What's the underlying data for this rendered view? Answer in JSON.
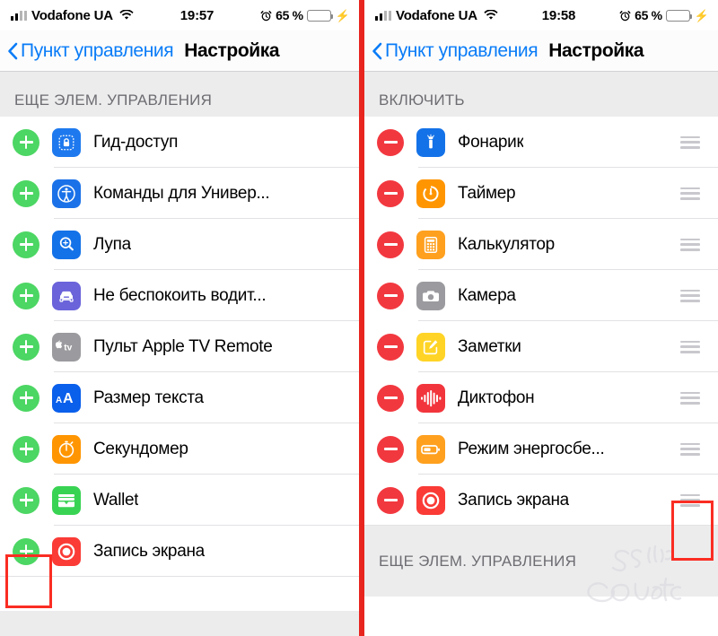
{
  "status_bar": {
    "carrier": "Vodafone UA",
    "signal_icon": "cellular-signal-icon",
    "wifi_icon": "wifi-icon",
    "alarm_icon": "alarm-clock-icon",
    "battery_icon": "battery-icon",
    "charging_icon": "lightning-bolt-icon",
    "battery_percent": "65 %",
    "battery_level": 65,
    "battery_color": "#ffcc00",
    "time_left": "19:57",
    "time_right": "19:58"
  },
  "nav": {
    "back_icon": "chevron-left-icon",
    "back_label": "Пункт управления",
    "title": "Настройка",
    "tint_color": "#0a7cf7"
  },
  "left_panel": {
    "section_header": "ЕЩЕ ЭЛЕМ. УПРАВЛЕНИЯ",
    "items": [
      {
        "label": "Гид-доступ",
        "icon": "guided-access-icon",
        "icon_color": "#1e79ee",
        "toggle": "add-icon"
      },
      {
        "label": "Команды для Универ...",
        "icon": "accessibility-icon",
        "icon_color": "#1b72e8",
        "toggle": "add-icon"
      },
      {
        "label": "Лупа",
        "icon": "magnifier-icon",
        "icon_color": "#1472e8",
        "toggle": "add-icon"
      },
      {
        "label": "Не беспокоить водит...",
        "icon": "car-icon",
        "icon_color": "#6a63da",
        "toggle": "add-icon"
      },
      {
        "label": "Пульт Apple TV Remote",
        "icon": "apple-tv-remote-icon",
        "icon_color": "#9b9b9f",
        "toggle": "add-icon"
      },
      {
        "label": "Размер текста",
        "icon": "text-size-icon",
        "icon_color": "#0a5feb",
        "toggle": "add-icon"
      },
      {
        "label": "Секундомер",
        "icon": "stopwatch-icon",
        "icon_color": "#ff9500",
        "toggle": "add-icon"
      },
      {
        "label": "Wallet",
        "icon": "wallet-icon",
        "icon_color": "#39d353",
        "toggle": "add-icon"
      },
      {
        "label": "Запись экрана",
        "icon": "screen-record-icon",
        "icon_color": "#fa3b36",
        "toggle": "add-icon"
      }
    ],
    "highlight": {
      "target": "add-toggle-screen-recording",
      "color": "#fa2d23"
    }
  },
  "right_panel": {
    "section_header_top": "ВКЛЮЧИТЬ",
    "section_header_bottom": "ЕЩЕ ЭЛЕМ. УПРАВЛЕНИЯ",
    "items": [
      {
        "label": "Фонарик",
        "icon": "flashlight-icon",
        "icon_color": "#1472e8",
        "toggle": "remove-icon",
        "handle": "drag-handle-icon"
      },
      {
        "label": "Таймер",
        "icon": "timer-icon",
        "icon_color": "#ff9500",
        "toggle": "remove-icon",
        "handle": "drag-handle-icon"
      },
      {
        "label": "Калькулятор",
        "icon": "calculator-icon",
        "icon_color": "#ffa01f",
        "toggle": "remove-icon",
        "handle": "drag-handle-icon"
      },
      {
        "label": "Камера",
        "icon": "camera-icon",
        "icon_color": "#9b9b9f",
        "toggle": "remove-icon",
        "handle": "drag-handle-icon"
      },
      {
        "label": "Заметки",
        "icon": "notes-icon",
        "icon_color": "#ffd426",
        "toggle": "remove-icon",
        "handle": "drag-handle-icon"
      },
      {
        "label": "Диктофон",
        "icon": "voice-memos-icon",
        "icon_color": "#f2353c",
        "toggle": "remove-icon",
        "handle": "drag-handle-icon"
      },
      {
        "label": "Режим энергосбе...",
        "icon": "low-power-icon",
        "icon_color": "#ffa01f",
        "toggle": "remove-icon",
        "handle": "drag-handle-icon"
      },
      {
        "label": "Запись экрана",
        "icon": "screen-record-icon",
        "icon_color": "#fa3b36",
        "toggle": "remove-icon",
        "handle": "drag-handle-icon"
      }
    ],
    "highlight": {
      "target": "drag-handle-screen-recording",
      "color": "#fa2d23"
    }
  },
  "watermark": {
    "text_top": "Sovet",
    "text_script": "club"
  },
  "divider_color": "#e8251f"
}
